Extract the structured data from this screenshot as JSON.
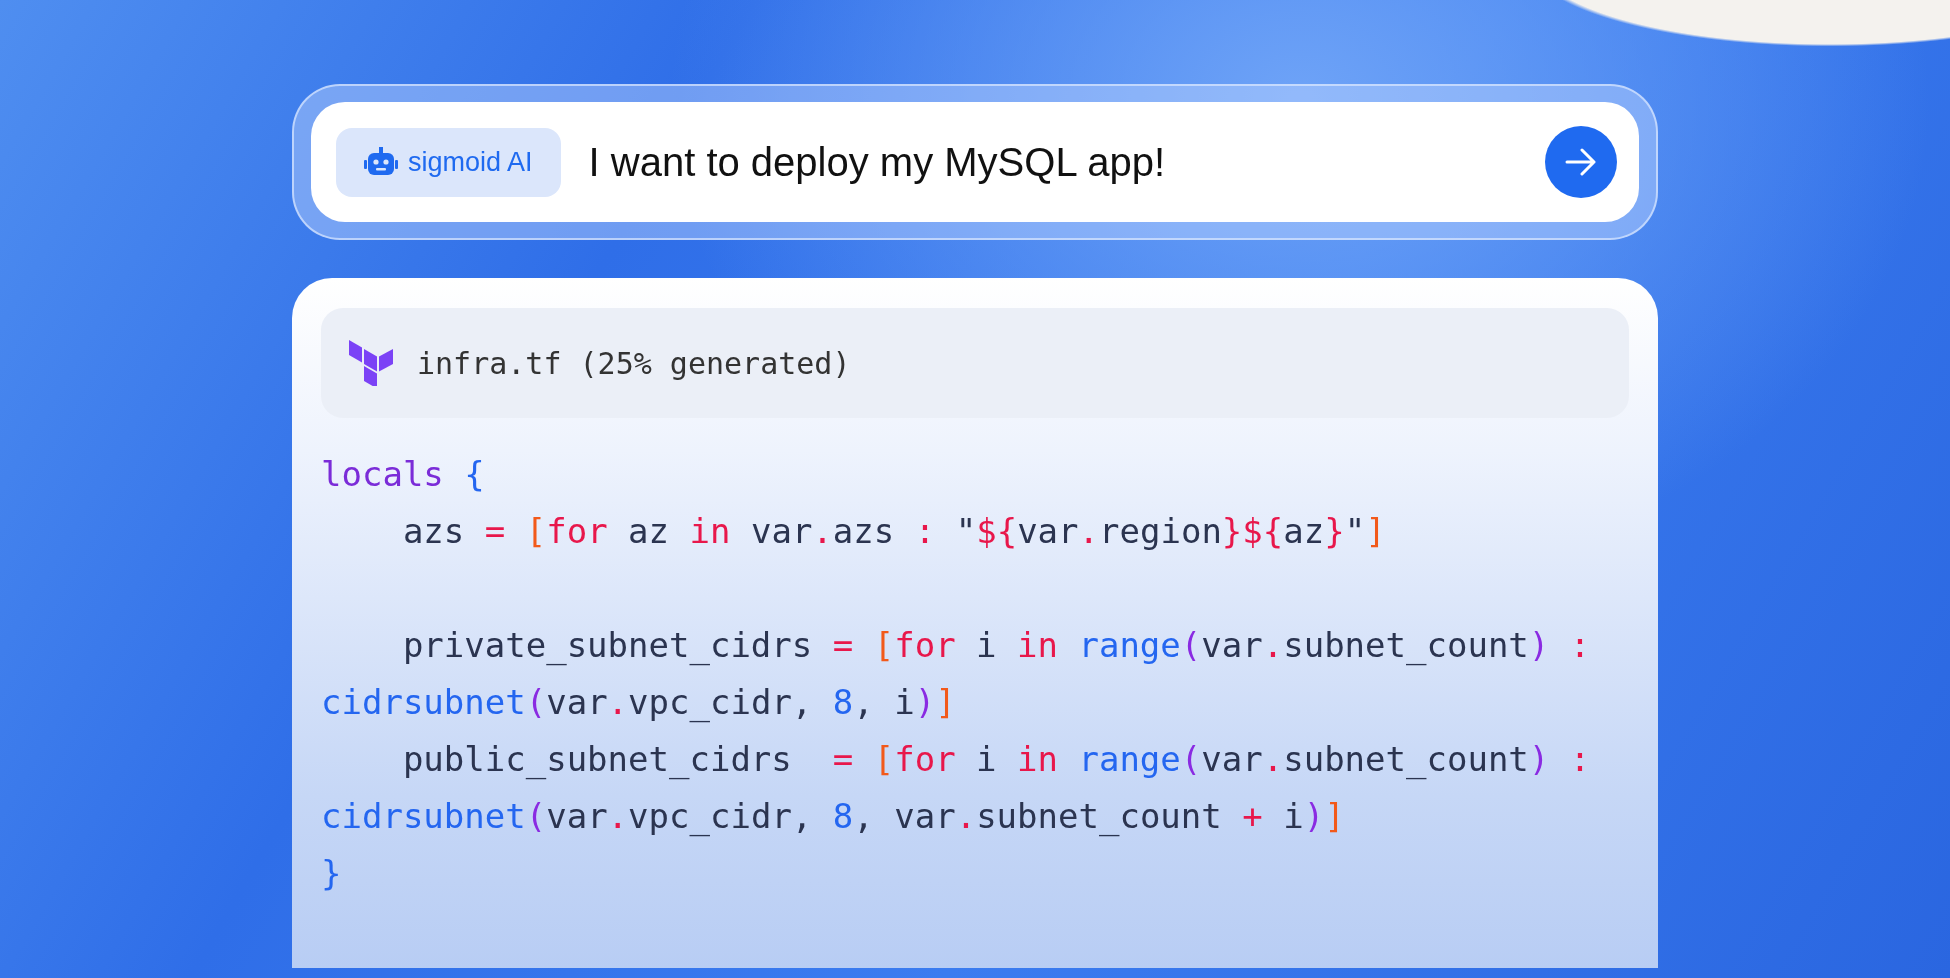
{
  "prompt": {
    "badge": "sigmoid AI",
    "value": "I want to deploy my MySQL app!"
  },
  "code_card": {
    "file_title": "infra.tf (25% generated)",
    "lines": [
      {
        "kind": "code",
        "tokens": [
          {
            "text": "locals",
            "kind": "kw"
          },
          {
            "text": " {",
            "kind": "brace"
          }
        ]
      },
      {
        "kind": "code",
        "tokens": [
          {
            "text": "    azs ",
            "kind": "text"
          },
          {
            "text": "= ",
            "kind": "op"
          },
          {
            "text": "[",
            "kind": "bracket"
          },
          {
            "text": "for",
            "kind": "op"
          },
          {
            "text": " az ",
            "kind": "text"
          },
          {
            "text": "in",
            "kind": "op"
          },
          {
            "text": " var",
            "kind": "text"
          },
          {
            "text": ".",
            "kind": "op"
          },
          {
            "text": "azs ",
            "kind": "text"
          },
          {
            "text": ":",
            "kind": "op"
          },
          {
            "text": " \"",
            "kind": "text"
          },
          {
            "text": "${",
            "kind": "op"
          },
          {
            "text": "var",
            "kind": "text"
          },
          {
            "text": ".",
            "kind": "op"
          },
          {
            "text": "region",
            "kind": "text"
          },
          {
            "text": "}${",
            "kind": "op"
          },
          {
            "text": "az",
            "kind": "text"
          },
          {
            "text": "}",
            "kind": "op"
          },
          {
            "text": "\"",
            "kind": "text"
          },
          {
            "text": "]",
            "kind": "bracket"
          }
        ]
      },
      {
        "kind": "blank"
      },
      {
        "kind": "code",
        "tokens": [
          {
            "text": "    private_subnet_cidrs ",
            "kind": "text"
          },
          {
            "text": "= ",
            "kind": "op"
          },
          {
            "text": "[",
            "kind": "bracket"
          },
          {
            "text": "for",
            "kind": "op"
          },
          {
            "text": " i ",
            "kind": "text"
          },
          {
            "text": "in ",
            "kind": "op"
          },
          {
            "text": "range",
            "kind": "fn"
          },
          {
            "text": "(",
            "kind": "paren"
          },
          {
            "text": "var",
            "kind": "text"
          },
          {
            "text": ".",
            "kind": "op"
          },
          {
            "text": "subnet_count",
            "kind": "text"
          },
          {
            "text": ")",
            "kind": "paren"
          },
          {
            "text": " :",
            "kind": "op"
          }
        ]
      },
      {
        "kind": "code",
        "tokens": [
          {
            "text": "cidrsubnet",
            "kind": "fn"
          },
          {
            "text": "(",
            "kind": "paren"
          },
          {
            "text": "var",
            "kind": "text"
          },
          {
            "text": ".",
            "kind": "op"
          },
          {
            "text": "vpc_cidr, ",
            "kind": "text"
          },
          {
            "text": "8",
            "kind": "num"
          },
          {
            "text": ", i",
            "kind": "text"
          },
          {
            "text": ")",
            "kind": "paren"
          },
          {
            "text": "]",
            "kind": "bracket"
          }
        ]
      },
      {
        "kind": "code",
        "tokens": [
          {
            "text": "    public_subnet_cidrs  ",
            "kind": "text"
          },
          {
            "text": "= ",
            "kind": "op"
          },
          {
            "text": "[",
            "kind": "bracket"
          },
          {
            "text": "for",
            "kind": "op"
          },
          {
            "text": " i ",
            "kind": "text"
          },
          {
            "text": "in ",
            "kind": "op"
          },
          {
            "text": "range",
            "kind": "fn"
          },
          {
            "text": "(",
            "kind": "paren"
          },
          {
            "text": "var",
            "kind": "text"
          },
          {
            "text": ".",
            "kind": "op"
          },
          {
            "text": "subnet_count",
            "kind": "text"
          },
          {
            "text": ")",
            "kind": "paren"
          },
          {
            "text": " :",
            "kind": "op"
          }
        ]
      },
      {
        "kind": "code",
        "tokens": [
          {
            "text": "cidrsubnet",
            "kind": "fn"
          },
          {
            "text": "(",
            "kind": "paren"
          },
          {
            "text": "var",
            "kind": "text"
          },
          {
            "text": ".",
            "kind": "op"
          },
          {
            "text": "vpc_cidr, ",
            "kind": "text"
          },
          {
            "text": "8",
            "kind": "num"
          },
          {
            "text": ", var",
            "kind": "text"
          },
          {
            "text": ".",
            "kind": "op"
          },
          {
            "text": "subnet_count ",
            "kind": "text"
          },
          {
            "text": "+",
            "kind": "op"
          },
          {
            "text": " i",
            "kind": "text"
          },
          {
            "text": ")",
            "kind": "paren"
          },
          {
            "text": "]",
            "kind": "bracket"
          }
        ]
      },
      {
        "kind": "code",
        "tokens": [
          {
            "text": "}",
            "kind": "brace"
          }
        ]
      }
    ]
  }
}
